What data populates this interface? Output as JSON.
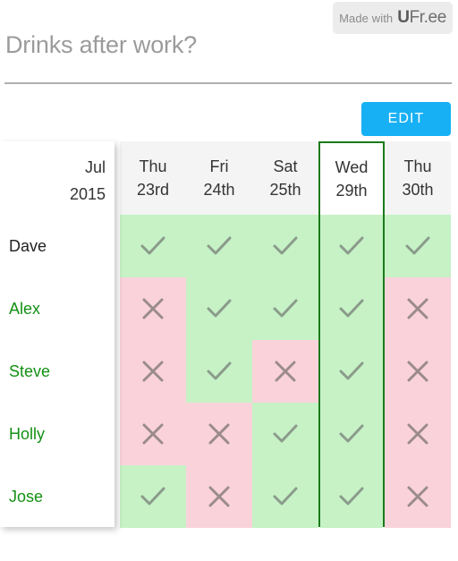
{
  "badge": {
    "prefix": "Made with",
    "brand_bold": "U",
    "brand_rest": "Fr.ee"
  },
  "header": {
    "title": "Drinks after work?",
    "edit_label": "EDIT"
  },
  "grid": {
    "corner": {
      "month": "Jul",
      "year": "2015"
    },
    "columns": [
      {
        "dow": "Thu",
        "dom": "23rd",
        "highlight": false
      },
      {
        "dow": "Fri",
        "dom": "24th",
        "highlight": false
      },
      {
        "dow": "Sat",
        "dom": "25th",
        "highlight": false
      },
      {
        "dow": "Wed",
        "dom": "29th",
        "highlight": true
      },
      {
        "dow": "Thu",
        "dom": "30th",
        "highlight": false
      }
    ],
    "rows": [
      {
        "name": "Dave",
        "owner": true,
        "votes": [
          "yes",
          "yes",
          "yes",
          "yes",
          "yes"
        ]
      },
      {
        "name": "Alex",
        "owner": false,
        "votes": [
          "no",
          "yes",
          "yes",
          "yes",
          "no"
        ]
      },
      {
        "name": "Steve",
        "owner": false,
        "votes": [
          "no",
          "yes",
          "no",
          "yes",
          "no"
        ]
      },
      {
        "name": "Holly",
        "owner": false,
        "votes": [
          "no",
          "no",
          "yes",
          "yes",
          "no"
        ]
      },
      {
        "name": "Jose",
        "owner": false,
        "votes": [
          "yes",
          "no",
          "yes",
          "yes",
          "no"
        ]
      }
    ]
  },
  "colors": {
    "yes_cell": "#c6f2c6",
    "no_cell": "#fad2da",
    "highlight_border": "#1a7a1a",
    "edit_button": "#17b0f4",
    "guest_name": "#149014",
    "title_text": "#9b9b9b"
  }
}
